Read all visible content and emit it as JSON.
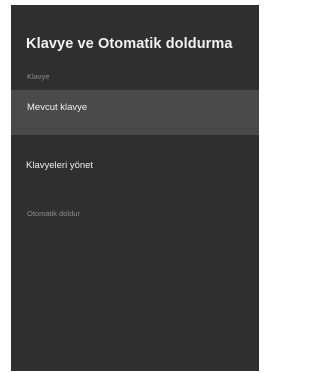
{
  "settings": {
    "title": "Klavye ve Otomatik doldurma",
    "sections": [
      {
        "header": "Klavye",
        "items": [
          {
            "label": "Mevcut klavye",
            "selected": true
          },
          {
            "label": "Klavyeleri yönet",
            "selected": false
          }
        ]
      },
      {
        "header": "Otomatik doldur",
        "items": []
      }
    ]
  }
}
